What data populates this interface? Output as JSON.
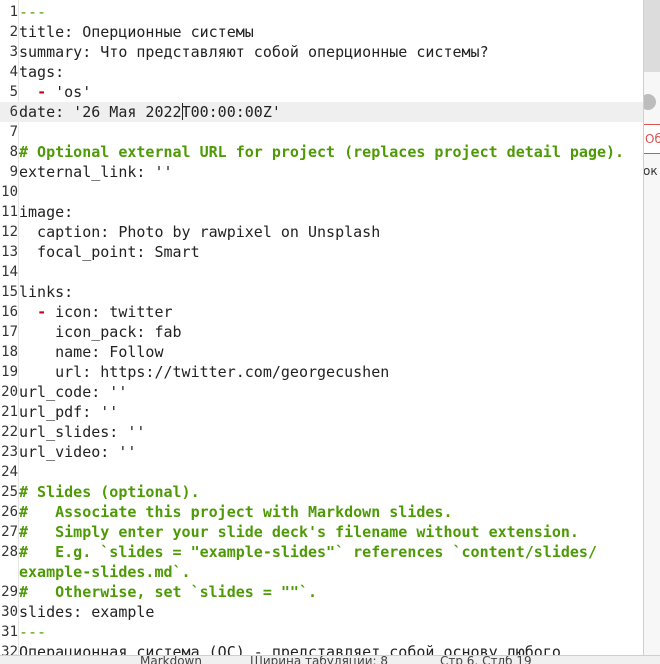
{
  "background_app": {
    "red_tab_text": "Об",
    "side_text": "ок"
  },
  "editor": {
    "cursor_line": 6,
    "lines": [
      {
        "n": "1",
        "segments": [
          {
            "t": "---",
            "c": "sep"
          }
        ]
      },
      {
        "n": "2",
        "segments": [
          {
            "t": "title: Оперционные системы",
            "c": ""
          }
        ]
      },
      {
        "n": "3",
        "segments": [
          {
            "t": "summary: Что представляют собой оперционные системы?",
            "c": ""
          }
        ]
      },
      {
        "n": "4",
        "segments": [
          {
            "t": "tags:",
            "c": ""
          }
        ]
      },
      {
        "n": "5",
        "segments": [
          {
            "t": "  ",
            "c": ""
          },
          {
            "t": "-",
            "c": "dash"
          },
          {
            "t": " 'os'",
            "c": ""
          }
        ]
      },
      {
        "n": "6",
        "segments": [
          {
            "t": "date: '26 Мая 2022",
            "c": ""
          },
          {
            "t": "|cursor|",
            "c": "cursor"
          },
          {
            "t": "T00:00:00Z'",
            "c": ""
          }
        ]
      },
      {
        "n": "7",
        "segments": []
      },
      {
        "n": "8",
        "segments": [
          {
            "t": "# Optional external URL for project (replaces project detail page).",
            "c": "comment"
          }
        ]
      },
      {
        "n": "9",
        "segments": [
          {
            "t": "external_link: ''",
            "c": ""
          }
        ]
      },
      {
        "n": "10",
        "segments": []
      },
      {
        "n": "11",
        "segments": [
          {
            "t": "image:",
            "c": ""
          }
        ]
      },
      {
        "n": "12",
        "segments": [
          {
            "t": "  caption: Photo by rawpixel on Unsplash",
            "c": ""
          }
        ]
      },
      {
        "n": "13",
        "segments": [
          {
            "t": "  focal_point: Smart",
            "c": ""
          }
        ]
      },
      {
        "n": "14",
        "segments": []
      },
      {
        "n": "15",
        "segments": [
          {
            "t": "links:",
            "c": ""
          }
        ]
      },
      {
        "n": "16",
        "segments": [
          {
            "t": "  ",
            "c": ""
          },
          {
            "t": "-",
            "c": "dash"
          },
          {
            "t": " icon: twitter",
            "c": ""
          }
        ]
      },
      {
        "n": "17",
        "segments": [
          {
            "t": "    icon_pack: fab",
            "c": ""
          }
        ]
      },
      {
        "n": "18",
        "segments": [
          {
            "t": "    name: Follow",
            "c": ""
          }
        ]
      },
      {
        "n": "19",
        "segments": [
          {
            "t": "    url: https://twitter.com/georgecushen",
            "c": ""
          }
        ]
      },
      {
        "n": "20",
        "segments": [
          {
            "t": "url_code: ''",
            "c": ""
          }
        ]
      },
      {
        "n": "21",
        "segments": [
          {
            "t": "url_pdf: ''",
            "c": ""
          }
        ]
      },
      {
        "n": "22",
        "segments": [
          {
            "t": "url_slides: ''",
            "c": ""
          }
        ]
      },
      {
        "n": "23",
        "segments": [
          {
            "t": "url_video: ''",
            "c": ""
          }
        ]
      },
      {
        "n": "24",
        "segments": []
      },
      {
        "n": "25",
        "segments": [
          {
            "t": "# Slides (optional).",
            "c": "comment"
          }
        ]
      },
      {
        "n": "26",
        "segments": [
          {
            "t": "#   Associate this project with Markdown slides.",
            "c": "comment"
          }
        ]
      },
      {
        "n": "27",
        "segments": [
          {
            "t": "#   Simply enter your slide deck's filename without extension.",
            "c": "comment"
          }
        ]
      },
      {
        "n": "28",
        "segments": [
          {
            "t": "#   E.g. `slides = \"example-slides\"` references `content/slides/",
            "c": "comment"
          }
        ]
      },
      {
        "n": "",
        "segments": [
          {
            "t": "example-slides.md`.",
            "c": "comment"
          }
        ]
      },
      {
        "n": "29",
        "segments": [
          {
            "t": "#   Otherwise, set `slides = \"\"`.",
            "c": "comment"
          }
        ]
      },
      {
        "n": "30",
        "segments": [
          {
            "t": "slides: example",
            "c": ""
          }
        ]
      },
      {
        "n": "31",
        "segments": [
          {
            "t": "---",
            "c": "sep"
          }
        ]
      },
      {
        "n": "32",
        "segments": [
          {
            "t": "Операционная система (ОС) - представляет собой основу любого",
            "c": ""
          }
        ]
      }
    ]
  },
  "statusbar": {
    "left": "Markdown",
    "middle": "Ширина табуляции: 8",
    "right": "Стр 6, Стлб 19"
  }
}
